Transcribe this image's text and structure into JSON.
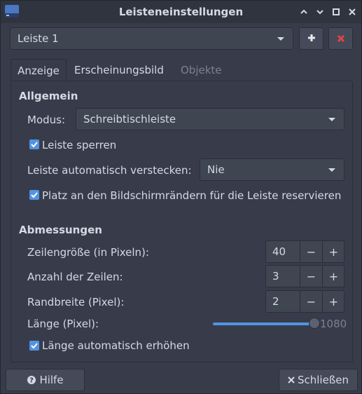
{
  "window": {
    "title": "Leisteneinstellungen"
  },
  "panel_selector": {
    "value": "Leiste 1"
  },
  "tabs": [
    {
      "label": "Anzeige",
      "active": true
    },
    {
      "label": "Erscheinungsbild",
      "active": false
    },
    {
      "label": "Objekte",
      "active": false,
      "disabled": true
    }
  ],
  "allgemein": {
    "heading": "Allgemein",
    "modus_label": "Modus:",
    "modus_value": "Schreibtischleiste",
    "lock_label": "Leiste sperren",
    "lock_checked": true,
    "autohide_label": "Leiste automatisch verstecken:",
    "autohide_value": "Nie",
    "reserve_label": "Platz an den Bildschirmrändern für die Leiste reservieren",
    "reserve_checked": true
  },
  "abmessungen": {
    "heading": "Abmessungen",
    "row_size_label": "Zeilengröße (in Pixeln):",
    "row_size_value": "40",
    "rows_label": "Anzahl der Zeilen:",
    "rows_value": "3",
    "border_label": "Randbreite (Pixel):",
    "border_value": "2",
    "length_label": "Länge (Pixel):",
    "length_value": "1080",
    "length_fraction": 1.0,
    "autolength_label": "Länge automatisch erhöhen",
    "autolength_checked": true
  },
  "footer": {
    "help_label": "Hilfe",
    "close_label": "Schließen"
  },
  "colors": {
    "accent": "#5294e2",
    "remove_red": "#e14245",
    "background": "#383c4a"
  }
}
